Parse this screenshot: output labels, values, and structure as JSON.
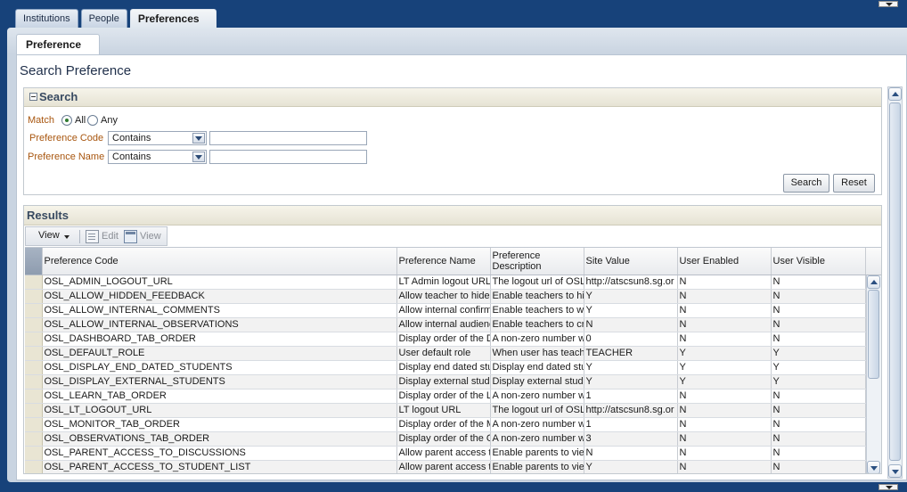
{
  "top_tabs": [
    {
      "label": "Institutions"
    },
    {
      "label": "People"
    },
    {
      "label": "Preferences"
    }
  ],
  "subtab": "Preference",
  "page_title": "Search Preference",
  "search": {
    "header": "Search",
    "match_label": "Match",
    "match_all": "All",
    "match_any": "Any",
    "match_selected": "All",
    "code_label": "Preference Code",
    "code_operator": "Contains",
    "code_value": "",
    "name_label": "Preference Name",
    "name_operator": "Contains",
    "name_value": "",
    "search_button": "Search",
    "reset_button": "Reset"
  },
  "results": {
    "header": "Results",
    "toolbar": {
      "view": "View",
      "edit": "Edit",
      "view_action": "View"
    },
    "columns": [
      "Preference Code",
      "Preference Name",
      "Preference Description",
      "Site Value",
      "User Enabled",
      "User Visible"
    ],
    "rows": [
      [
        "OSL_ADMIN_LOGOUT_URL",
        "LT Admin logout URL",
        "The logout url of OSL",
        "http://atscsun8.sg.or",
        "N",
        "N"
      ],
      [
        "OSL_ALLOW_HIDDEN_FEEDBACK",
        "Allow teacher to hide",
        "Enable teachers to hi",
        "Y",
        "N",
        "N"
      ],
      [
        "OSL_ALLOW_INTERNAL_COMMENTS",
        "Allow internal confirm",
        "Enable teachers to w",
        "Y",
        "N",
        "N"
      ],
      [
        "OSL_ALLOW_INTERNAL_OBSERVATIONS",
        "Allow internal audienc",
        "Enable teachers to cr",
        "N",
        "N",
        "N"
      ],
      [
        "OSL_DASHBOARD_TAB_ORDER",
        "Display order of the D",
        "A non-zero number w",
        "0",
        "N",
        "N"
      ],
      [
        "OSL_DEFAULT_ROLE",
        "User default role",
        "When user has teach",
        "TEACHER",
        "Y",
        "Y"
      ],
      [
        "OSL_DISPLAY_END_DATED_STUDENTS",
        "Display end dated stu",
        "Display end dated stu",
        "Y",
        "Y",
        "Y"
      ],
      [
        "OSL_DISPLAY_EXTERNAL_STUDENTS",
        "Display external stude",
        "Display external stude",
        "Y",
        "Y",
        "Y"
      ],
      [
        "OSL_LEARN_TAB_ORDER",
        "Display order of the L",
        "A non-zero number w",
        "1",
        "N",
        "N"
      ],
      [
        "OSL_LT_LOGOUT_URL",
        "LT logout URL",
        "The logout url of OSL",
        "http://atscsun8.sg.or",
        "N",
        "N"
      ],
      [
        "OSL_MONITOR_TAB_ORDER",
        "Display order of the M",
        "A non-zero number w",
        "1",
        "N",
        "N"
      ],
      [
        "OSL_OBSERVATIONS_TAB_ORDER",
        "Display order of the O",
        "A non-zero number w",
        "3",
        "N",
        "N"
      ],
      [
        "OSL_PARENT_ACCESS_TO_DISCUSSIONS",
        "Allow parent access t",
        "Enable parents to vie",
        "N",
        "N",
        "N"
      ],
      [
        "OSL_PARENT_ACCESS_TO_STUDENT_LIST",
        "Allow parent access t",
        "Enable parents to vie",
        "Y",
        "N",
        "N"
      ]
    ]
  }
}
